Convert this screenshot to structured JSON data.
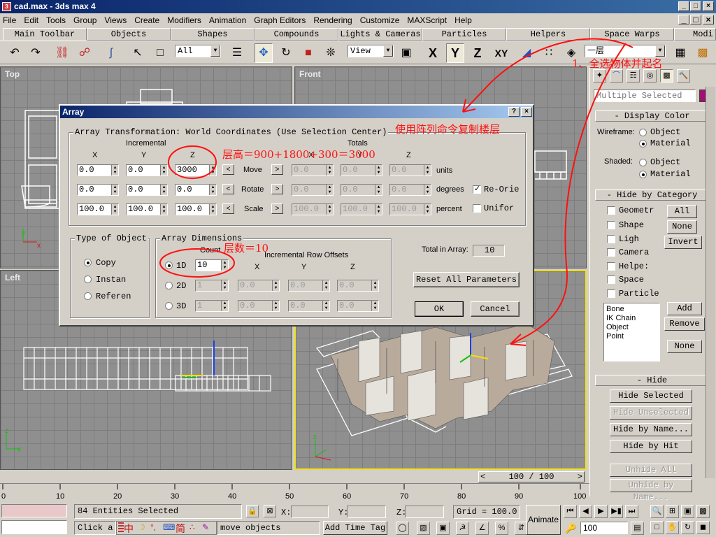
{
  "window": {
    "title": "cad.max - 3ds max 4",
    "controls": [
      "_",
      "□",
      "×"
    ],
    "doc_controls": [
      "_",
      "□",
      "×"
    ]
  },
  "menu": [
    "File",
    "Edit",
    "Tools",
    "Group",
    "Views",
    "Create",
    "Modifiers",
    "Animation",
    "Graph Editors",
    "Rendering",
    "Customize",
    "MAXScript",
    "Help"
  ],
  "tabs": [
    "Main Toolbar",
    "Objects",
    "Shapes",
    "Compounds",
    "Lights & Cameras",
    "Particles",
    "Helpers",
    "Space Warps",
    "Modi"
  ],
  "toolbar": {
    "filter": "All",
    "ref_coord": "View",
    "axis_x": "X",
    "axis_y": "Y",
    "axis_z": "Z",
    "axis_xy": "XY",
    "named_selection": "一层"
  },
  "viewports": {
    "top": "Top",
    "front": "Front",
    "left": "Left"
  },
  "command_panel": {
    "name_field": "Multiple Selected",
    "display_color": {
      "title": "Display Color",
      "wireframe_label": "Wireframe:",
      "shaded_label": "Shaded:",
      "object": "Object",
      "material": "Material"
    },
    "hide_by_category": {
      "title": "Hide by Category",
      "items": [
        "Geometr",
        "Shape",
        "Ligh",
        "Camera",
        "Helpe:",
        "Space",
        "Particle"
      ],
      "all": "All",
      "none": "None",
      "invert": "Invert",
      "list": [
        "Bone",
        "IK Chain Object",
        "Point"
      ],
      "add": "Add",
      "remove": "Remove",
      "none2": "None"
    },
    "hide": {
      "title": "Hide",
      "hide_selected": "Hide Selected",
      "hide_unselected": "Hide Unselected",
      "hide_by_name": "Hide by Name...",
      "hide_by_hit": "Hide by Hit",
      "unhide_all": "Unhide All",
      "unhide_by_name": "Unhide by Name..."
    }
  },
  "dialog": {
    "title": "Array",
    "help": "?",
    "close": "×",
    "transform_title": "Array Transformation: World Coordinates (Use Selection Center)",
    "incremental": "Incremental",
    "totals": "Totals",
    "x": "X",
    "y": "Y",
    "z": "Z",
    "rows": [
      {
        "label": "Move",
        "inc": [
          "0.0",
          "0.0",
          "3000"
        ],
        "tot": [
          "0.0",
          "0.0",
          "0.0"
        ],
        "unit": "units",
        "check": "Re-Orie",
        "checked": true
      },
      {
        "label": "Rotate",
        "inc": [
          "0.0",
          "0.0",
          "0.0"
        ],
        "tot": [
          "0.0",
          "0.0",
          "0.0"
        ],
        "unit": "degrees"
      },
      {
        "label": "Scale",
        "inc": [
          "100.0",
          "100.0",
          "100.0"
        ],
        "tot": [
          "100.0",
          "100.0",
          "100.0"
        ],
        "unit": "percent",
        "check": "Unifor",
        "checked": false
      }
    ],
    "type_title": "Type of Object",
    "types": [
      "Copy",
      "Instan",
      "Referen"
    ],
    "dims_title": "Array Dimensions",
    "count_label": "Count",
    "row_offsets": "Incremental Row Offsets",
    "dims": [
      {
        "label": "1D",
        "count": "10",
        "x": "",
        "y": "",
        "z": ""
      },
      {
        "label": "2D",
        "count": "1",
        "x": "0.0",
        "y": "0.0",
        "z": "0.0"
      },
      {
        "label": "3D",
        "count": "1",
        "x": "0.0",
        "y": "0.0",
        "z": "0.0"
      }
    ],
    "total_label": "Total in Array:",
    "total": "10",
    "reset": "Reset All Parameters",
    "ok": "OK",
    "cancel": "Cancel"
  },
  "annotations": {
    "select_and_name": "1、全选物体并起名",
    "use_array": "使用阵列命令复制楼层",
    "floor_height": "层高＝900+1800+300＝3000",
    "layers": "层数＝10"
  },
  "timeline": {
    "slider": "100 / 100",
    "ticks": [
      "0",
      "10",
      "20",
      "30",
      "40",
      "50",
      "60",
      "70",
      "80",
      "90",
      "100"
    ]
  },
  "status": {
    "selected": "84 Entities Selected",
    "prompt": "Click a",
    "prompt2": "move objects",
    "x_label": "X:",
    "y_label": "Y:",
    "z_label": "Z:",
    "grid": "Grid = 100.0",
    "add_time_tag": "Add Time Tag",
    "animate": "Animate",
    "frame": "100",
    "ime": "中",
    "ime2": "简"
  }
}
